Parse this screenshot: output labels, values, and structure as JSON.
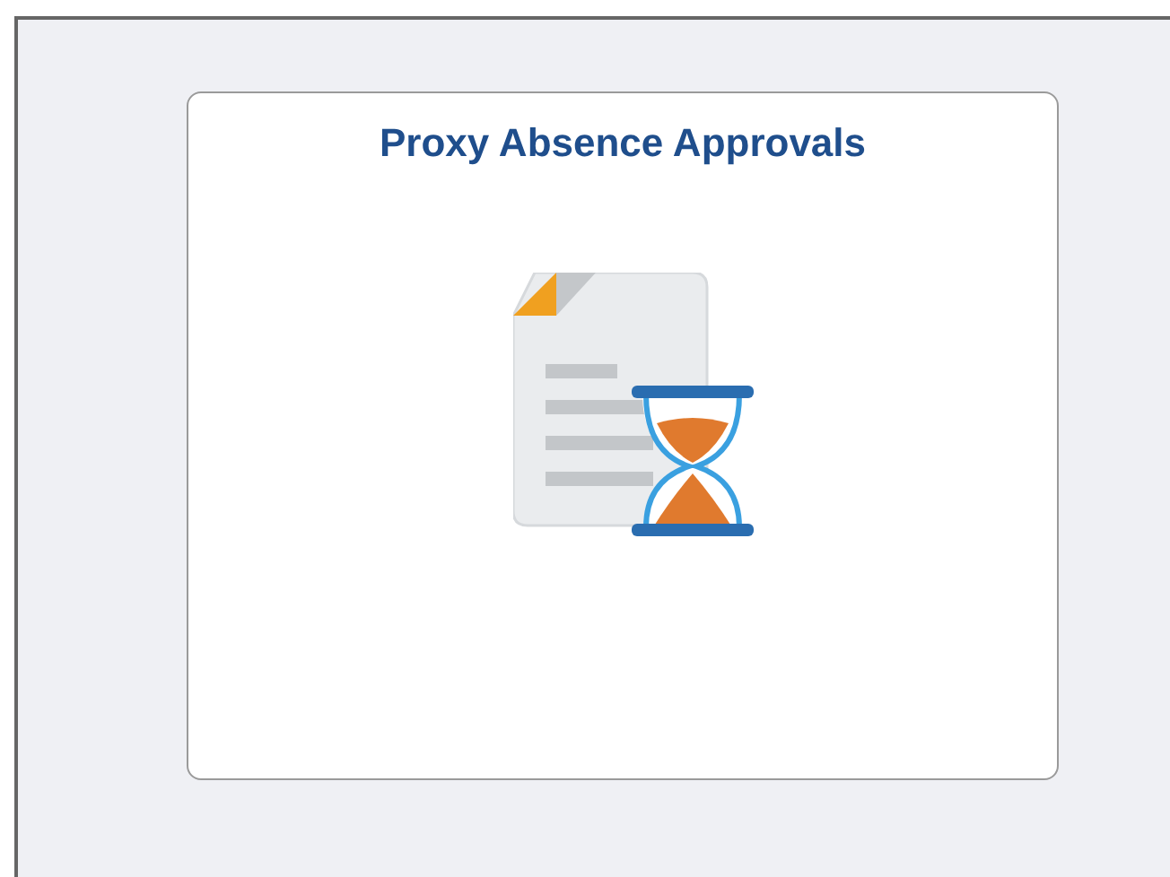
{
  "tile": {
    "title": "Proxy Absence Approvals"
  }
}
